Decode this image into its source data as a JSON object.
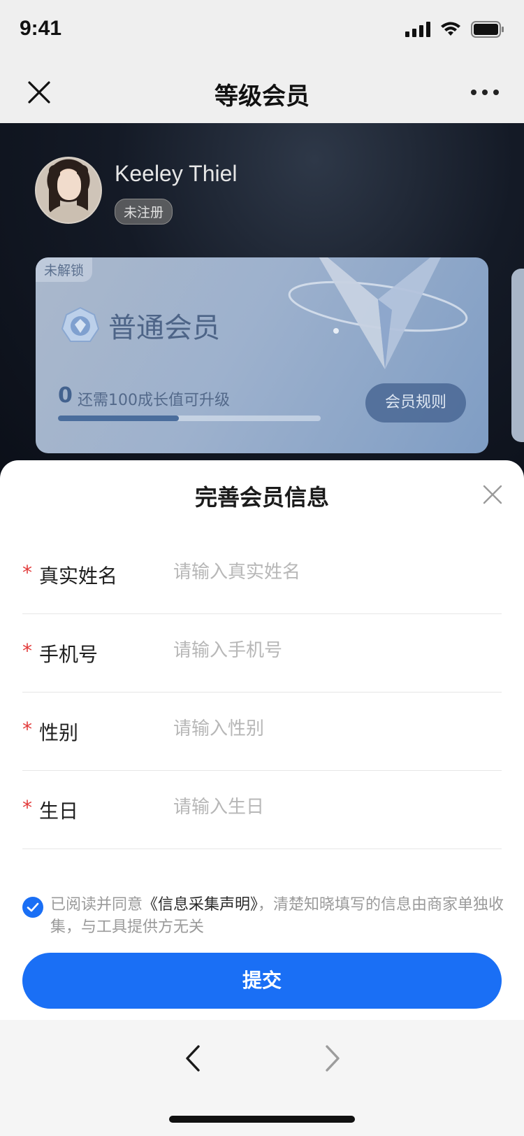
{
  "status": {
    "time": "9:41"
  },
  "nav": {
    "title": "等级会员"
  },
  "user": {
    "name": "Keeley Thiel",
    "badge": "未注册"
  },
  "card": {
    "lock_label": "未解锁",
    "level_name": "普通会员",
    "progress_value": "0",
    "progress_hint": "还需100成长值可升级",
    "progress_fraction": 0.46,
    "rules_button": "会员规则"
  },
  "sheet": {
    "title": "完善会员信息",
    "fields": [
      {
        "required": "*",
        "label": "真实姓名",
        "placeholder": "请输入真实姓名"
      },
      {
        "required": "*",
        "label": "手机号",
        "placeholder": "请输入手机号"
      },
      {
        "required": "*",
        "label": "性别",
        "placeholder": "请输入性别"
      },
      {
        "required": "*",
        "label": "生日",
        "placeholder": "请输入生日"
      }
    ],
    "agreement": {
      "prefix": "已阅读并同意",
      "link": "《信息采集声明》",
      "suffix": "，清楚知晓填写的信息由商家单独收集，与工具提供方无关"
    },
    "submit": "提交"
  },
  "colors": {
    "accent": "#1a6ff5",
    "required": "#e23a3a"
  }
}
